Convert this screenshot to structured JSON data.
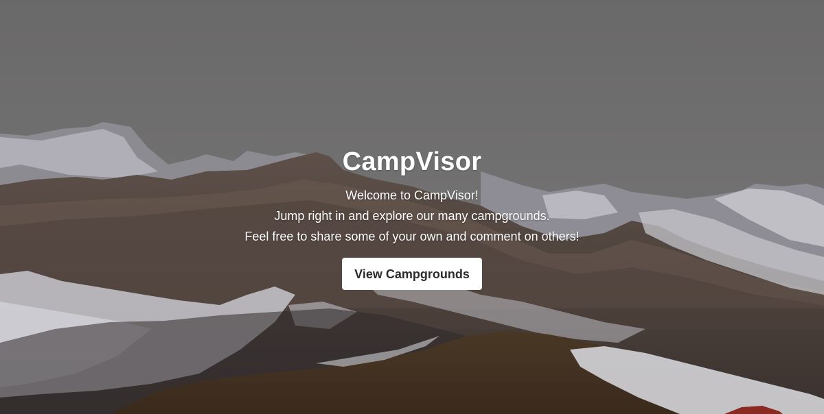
{
  "hero": {
    "title": "CampVisor",
    "lines": [
      "Welcome to CampVisor!",
      "Jump right in and explore our many campgrounds.",
      "Feel free to share some of your own and comment on others!"
    ],
    "button_label": "View Campgrounds"
  },
  "colors": {
    "sky": "#6b6a6b",
    "text": "#ffffff",
    "button_bg": "#ffffff",
    "button_text": "#2b2b2b"
  }
}
